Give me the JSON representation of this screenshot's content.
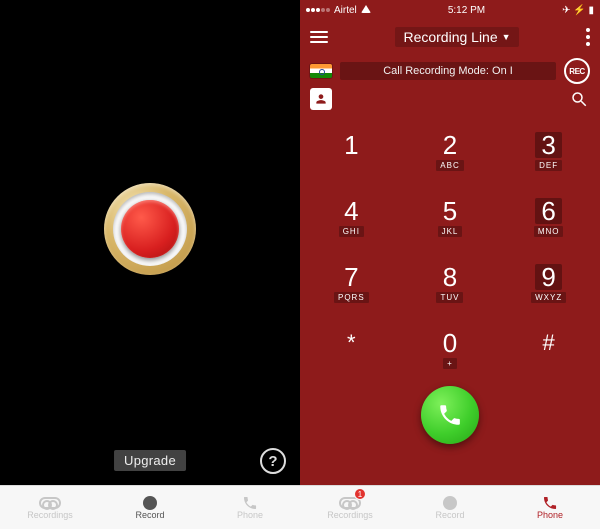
{
  "left": {
    "upgrade_label": "Upgrade",
    "help_glyph": "?",
    "tabs": {
      "recordings": "Recordings",
      "record": "Record",
      "phone": "Phone"
    }
  },
  "right": {
    "status": {
      "carrier": "Airtel",
      "time": "5:12 PM",
      "right_icons": "✈ ⚡ ▮"
    },
    "header": {
      "title": "Recording Line",
      "dropdown_marker": "▼"
    },
    "mode_text": "Call Recording Mode: On I",
    "rec_badge": "REC",
    "keypad": [
      {
        "digit": "1",
        "letters": ""
      },
      {
        "digit": "2",
        "letters": "ABC"
      },
      {
        "digit": "3",
        "letters": "DEF",
        "hl": true
      },
      {
        "digit": "4",
        "letters": "GHI"
      },
      {
        "digit": "5",
        "letters": "JKL"
      },
      {
        "digit": "6",
        "letters": "MNO",
        "hl": true
      },
      {
        "digit": "7",
        "letters": "PQRS"
      },
      {
        "digit": "8",
        "letters": "TUV"
      },
      {
        "digit": "9",
        "letters": "WXYZ",
        "hl": true
      },
      {
        "digit": "*",
        "letters": "",
        "sym": true
      },
      {
        "digit": "0",
        "letters": "+"
      },
      {
        "digit": "#",
        "letters": "",
        "sym": true
      }
    ],
    "tabs": {
      "recordings": "Recordings",
      "record": "Record",
      "phone": "Phone",
      "recordings_badge": "1"
    }
  }
}
